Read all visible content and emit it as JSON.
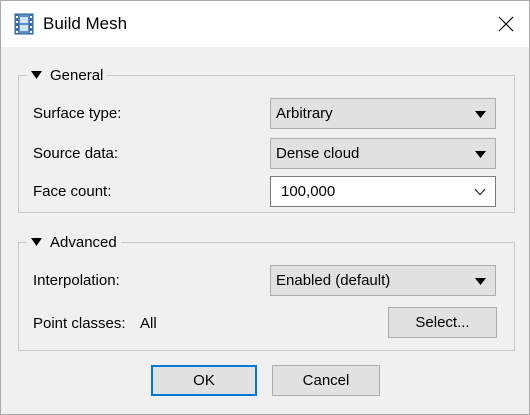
{
  "window": {
    "title": "Build Mesh",
    "icon": "film-strip-icon"
  },
  "general": {
    "legend": "General",
    "surface_type": {
      "label": "Surface type:",
      "value": "Arbitrary"
    },
    "source_data": {
      "label": "Source data:",
      "value": "Dense cloud"
    },
    "face_count": {
      "label": "Face count:",
      "value": "100,000"
    }
  },
  "advanced": {
    "legend": "Advanced",
    "interpolation": {
      "label": "Interpolation:",
      "value": "Enabled (default)"
    },
    "point_classes": {
      "label": "Point classes:",
      "value": "All",
      "button": "Select..."
    }
  },
  "buttons": {
    "ok": "OK",
    "cancel": "Cancel"
  },
  "colors": {
    "accent": "#0078d7",
    "button_bg": "#e1e1e1",
    "dialog_bg": "#f0f0f0"
  }
}
